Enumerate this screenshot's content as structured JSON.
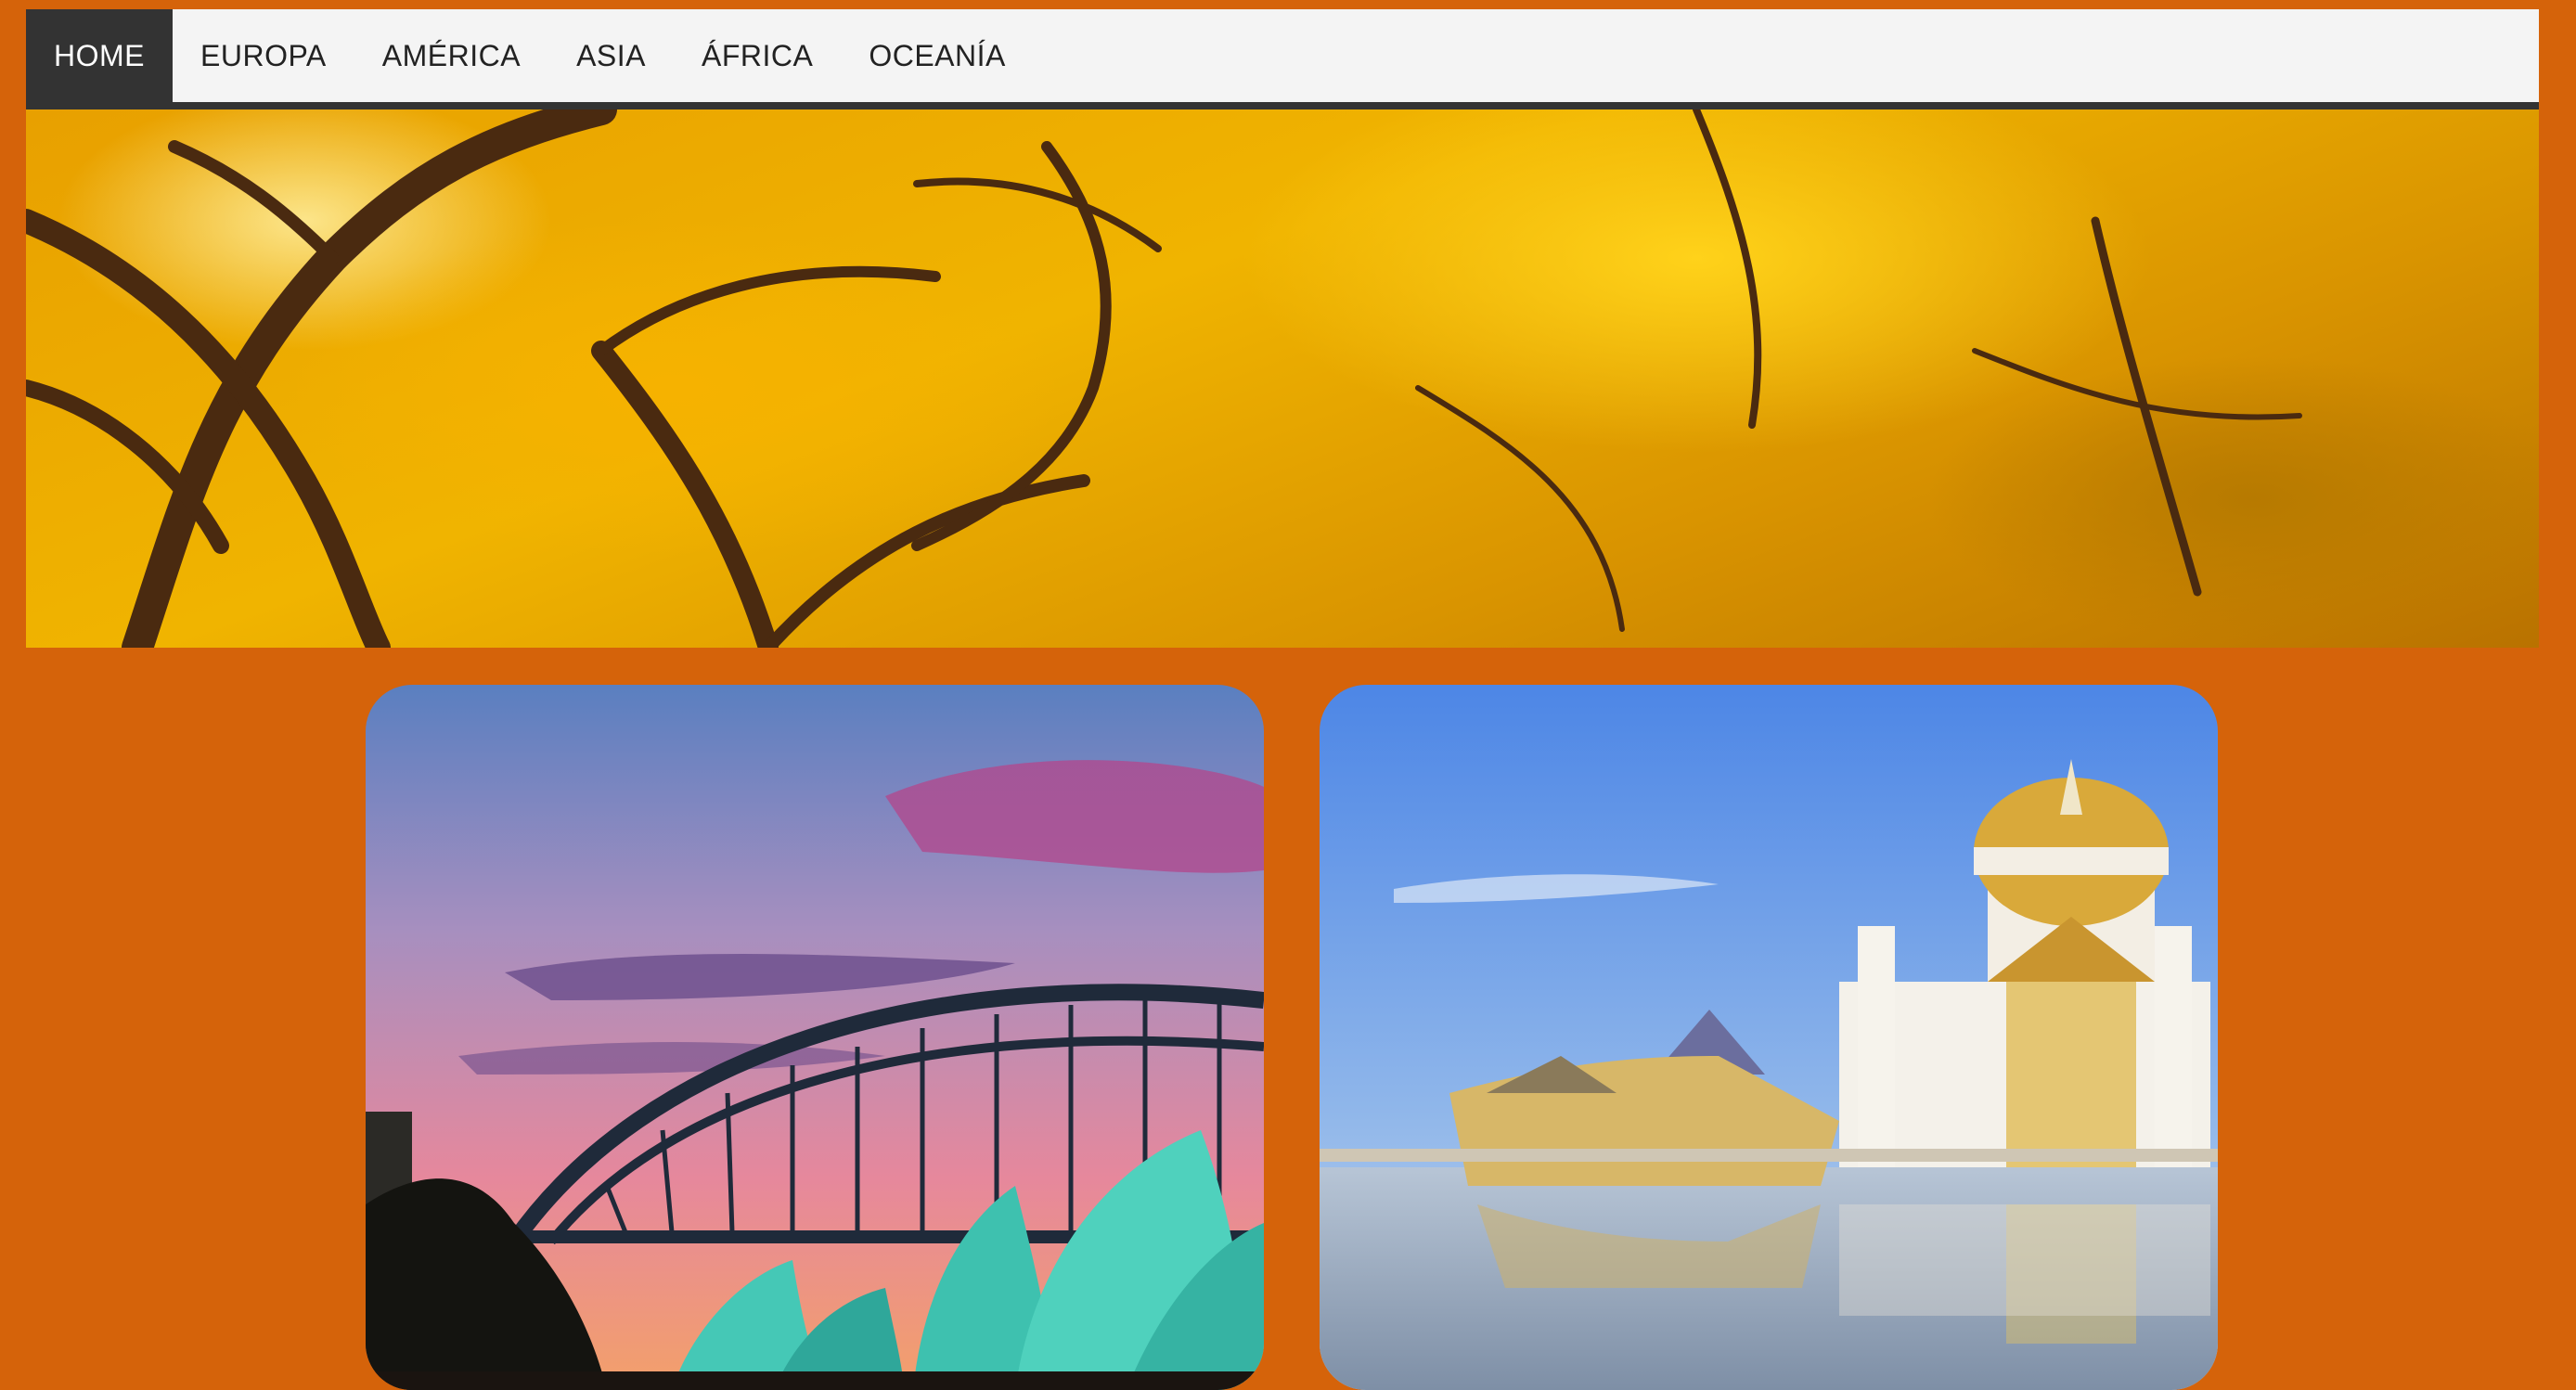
{
  "nav": {
    "items": [
      {
        "label": "HOME",
        "active": true
      },
      {
        "label": "EUROPA",
        "active": false
      },
      {
        "label": "AMÉRICA",
        "active": false
      },
      {
        "label": "ASIA",
        "active": false
      },
      {
        "label": "ÁFRICA",
        "active": false
      },
      {
        "label": "OCEANÍA",
        "active": false
      }
    ]
  },
  "colors": {
    "page_background": "#d5630a",
    "nav_background": "#f4f4f4",
    "nav_active": "#333333"
  }
}
